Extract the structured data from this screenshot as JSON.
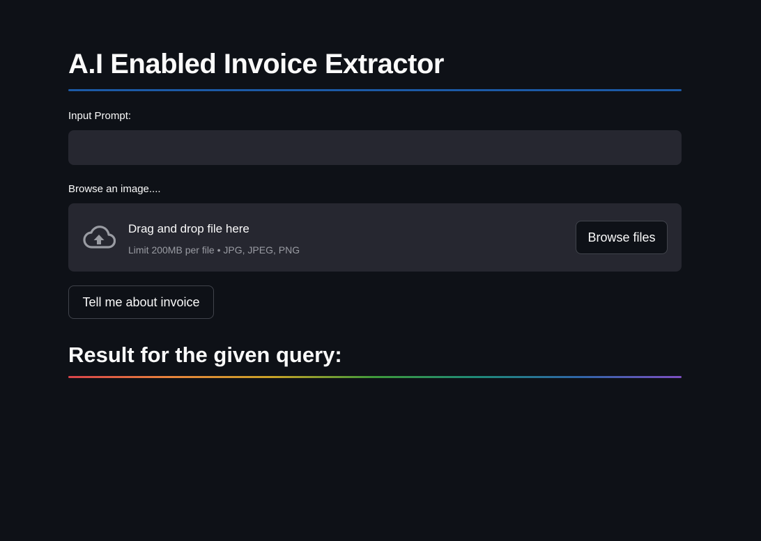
{
  "header": {
    "title": "A.I Enabled Invoice Extractor"
  },
  "prompt": {
    "label": "Input Prompt:",
    "value": "",
    "placeholder": ""
  },
  "uploader": {
    "label": "Browse an image....",
    "icon": "cloud-upload-icon",
    "drop_text": "Drag and drop file here",
    "limit_text": "Limit 200MB per file • JPG, JPEG, PNG",
    "browse_label": "Browse files"
  },
  "submit": {
    "label": "Tell me about invoice"
  },
  "result": {
    "heading": "Result for the given query:"
  },
  "colors": {
    "background": "#0e1117",
    "surface": "#262730",
    "title_divider": "#1c5aa6",
    "text": "#fafafa",
    "muted_text": "#9a9ca3"
  }
}
